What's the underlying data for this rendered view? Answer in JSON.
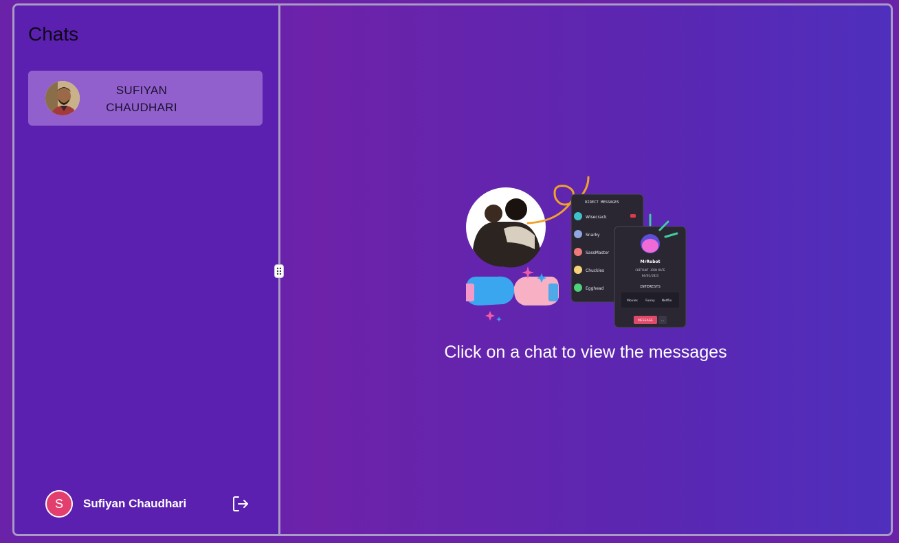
{
  "sidebar": {
    "title": "Chats",
    "chats": [
      {
        "name": "SUFIYAN CHAUDHARI"
      }
    ]
  },
  "current_user": {
    "initial": "S",
    "name": "Sufiyan Chaudhari",
    "avatar_color": "#e23e6e"
  },
  "main": {
    "empty_message": "Click on a chat to view the messages",
    "illustration": {
      "panel_title": "DIRECT MESSAGES",
      "contacts": [
        "Wisecrack",
        "Snarky",
        "SassMaster",
        "Chuckles",
        "Egghead"
      ],
      "profile_name": "MrRobot",
      "join_label": "CHITCHAT JOIN DATE",
      "join_date": "04/01/2023",
      "interests_label": "INTERESTS",
      "interests": [
        "Movies",
        "Funny",
        "Netflix"
      ],
      "message_button": "MESSAGE",
      "more_button": "..."
    }
  },
  "colors": {
    "background": "#6a22a8",
    "sidebar": "#5b20b0",
    "border": "#a99bc4",
    "accent": "#e23e6e"
  }
}
